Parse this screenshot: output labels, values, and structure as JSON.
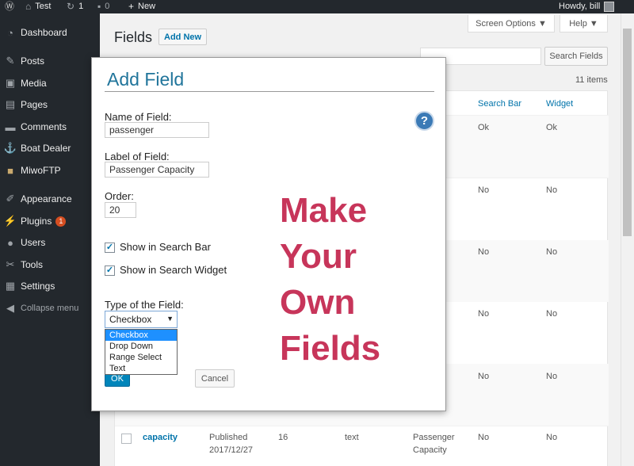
{
  "adminbar": {
    "site_name": "Test",
    "updates": "1",
    "comments": "0",
    "new_label": "New",
    "greeting": "Howdy, bill"
  },
  "sidebar": {
    "items": [
      {
        "label": "Dashboard",
        "icon": "dashboard-icon"
      },
      {
        "label": "Posts",
        "icon": "pin-icon"
      },
      {
        "label": "Media",
        "icon": "media-icon"
      },
      {
        "label": "Pages",
        "icon": "pages-icon"
      },
      {
        "label": "Comments",
        "icon": "comments-icon"
      },
      {
        "label": "Boat Dealer",
        "icon": "anchor-icon"
      },
      {
        "label": "MiwoFTP",
        "icon": "folder-icon"
      },
      {
        "label": "Appearance",
        "icon": "brush-icon"
      },
      {
        "label": "Plugins",
        "icon": "plugin-icon",
        "badge": "1"
      },
      {
        "label": "Users",
        "icon": "user-icon"
      },
      {
        "label": "Tools",
        "icon": "wrench-icon"
      },
      {
        "label": "Settings",
        "icon": "settings-icon"
      },
      {
        "label": "Collapse menu",
        "icon": "collapse-icon"
      }
    ]
  },
  "page": {
    "title": "Fields",
    "add_new": "Add New",
    "screen_options": "Screen Options ▼",
    "help": "Help ▼",
    "search_button": "Search Fields",
    "items_count": "11 items"
  },
  "table": {
    "headers": {
      "search_bar": "Search Bar",
      "widget": "Widget"
    },
    "rows": [
      {
        "partial": "",
        "search_bar": "Ok",
        "widget": "Ok"
      },
      {
        "partial": "rial",
        "search_bar": "No",
        "widget": "No"
      },
      {
        "partial": "",
        "search_bar": "No",
        "widget": "No"
      },
      {
        "partial": "",
        "search_bar": "No",
        "widget": "No"
      },
      {
        "partial": "olor",
        "search_bar": "No",
        "widget": "No"
      }
    ],
    "last_row": {
      "name": "capacity",
      "status": "Published",
      "date": "2017/12/27",
      "order": "16",
      "type": "text",
      "label_line1": "Passenger",
      "label_line2": "Capacity",
      "search_bar": "No",
      "widget": "No"
    }
  },
  "dialog": {
    "title": "Add Field",
    "name_label": "Name of Field:",
    "name_value": "passenger",
    "label_label": "Label of Field:",
    "label_value": "Passenger Capacity",
    "order_label": "Order:",
    "order_value": "20",
    "show_search_bar": "Show in Search Bar",
    "show_search_widget": "Show in Search Widget",
    "type_label": "Type of the Field:",
    "type_selected": "Checkbox",
    "type_options": [
      "Checkbox",
      "Drop Down",
      "Range Select",
      "Text"
    ],
    "ok": "OK",
    "cancel": "Cancel",
    "help_glyph": "?"
  },
  "promo": {
    "line1": "Make",
    "line2": "Your",
    "line3": "Own",
    "line4": "Fields",
    "color": "#c7355a"
  },
  "colors": {
    "admin_dark": "#23282d",
    "link_blue": "#0073aa",
    "primary_button": "#0085ba"
  }
}
